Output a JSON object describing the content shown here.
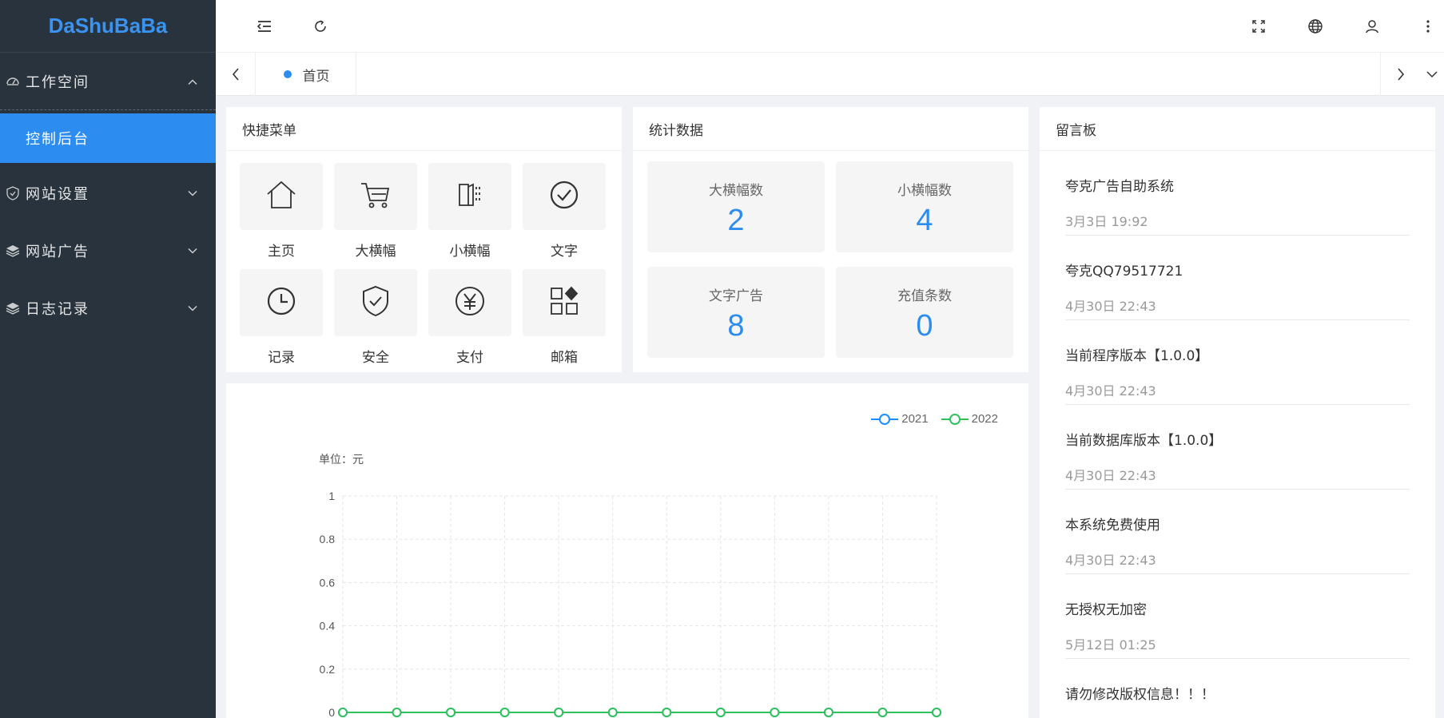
{
  "app": {
    "logo": "DaShuBaBa"
  },
  "sidebar": {
    "items": [
      {
        "label": "工作空间",
        "icon": "dashboard-icon",
        "expanded": true
      },
      {
        "label": "网站设置",
        "icon": "shield-icon",
        "expanded": false
      },
      {
        "label": "网站广告",
        "icon": "layers-icon",
        "expanded": false
      },
      {
        "label": "日志记录",
        "icon": "layers-icon",
        "expanded": false
      }
    ],
    "active_sub": "控制后台"
  },
  "tabs": {
    "home": "首页"
  },
  "quick_menu": {
    "title": "快捷菜单",
    "items": [
      {
        "label": "主页",
        "icon": "home-icon"
      },
      {
        "label": "大横幅",
        "icon": "cart-icon"
      },
      {
        "label": "小横幅",
        "icon": "book-icon"
      },
      {
        "label": "文字",
        "icon": "check-circle-icon"
      },
      {
        "label": "记录",
        "icon": "clock-icon"
      },
      {
        "label": "安全",
        "icon": "shield-check-icon"
      },
      {
        "label": "支付",
        "icon": "yen-icon"
      },
      {
        "label": "邮箱",
        "icon": "apps-icon"
      }
    ]
  },
  "stats": {
    "title": "统计数据",
    "items": [
      {
        "label": "大横幅数",
        "value": "2"
      },
      {
        "label": "小横幅数",
        "value": "4"
      },
      {
        "label": "文字广告",
        "value": "8"
      },
      {
        "label": "充值条数",
        "value": "0"
      }
    ]
  },
  "board": {
    "title": "留言板",
    "messages": [
      {
        "title": "夸克广告自助系统",
        "time": "3月3日 19:92"
      },
      {
        "title": "夸克QQ79517721",
        "time": "4月30日 22:43"
      },
      {
        "title": "当前程序版本【1.0.0】",
        "time": "4月30日 22:43"
      },
      {
        "title": "当前数据库版本【1.0.0】",
        "time": "4月30日 22:43"
      },
      {
        "title": "本系统免费使用",
        "time": "4月30日 22:43"
      },
      {
        "title": "无授权无加密",
        "time": "5月12日 01:25"
      },
      {
        "title": "请勿修改版权信息！！！",
        "time": ""
      }
    ]
  },
  "chart_data": {
    "type": "line",
    "unit_label": "单位：元",
    "x": [
      "",
      "",
      "",
      "",
      "",
      "",
      "",
      "",
      "",
      "",
      "",
      ""
    ],
    "yticks": [
      "1",
      "0.8",
      "0.6",
      "0.4",
      "0.2",
      "0"
    ],
    "ylim": [
      0,
      1
    ],
    "legend": "top-right",
    "series": [
      {
        "name": "2021",
        "color": "#1890ff",
        "values": [
          0,
          0,
          0,
          0,
          0,
          0,
          0,
          0,
          0,
          0,
          0,
          0
        ]
      },
      {
        "name": "2022",
        "color": "#2fc25b",
        "values": [
          0,
          0,
          0,
          0,
          0,
          0,
          0,
          0,
          0,
          0,
          0,
          0
        ]
      }
    ]
  },
  "colors": {
    "accent": "#2d8cf0",
    "sidebar": "#28333e"
  }
}
